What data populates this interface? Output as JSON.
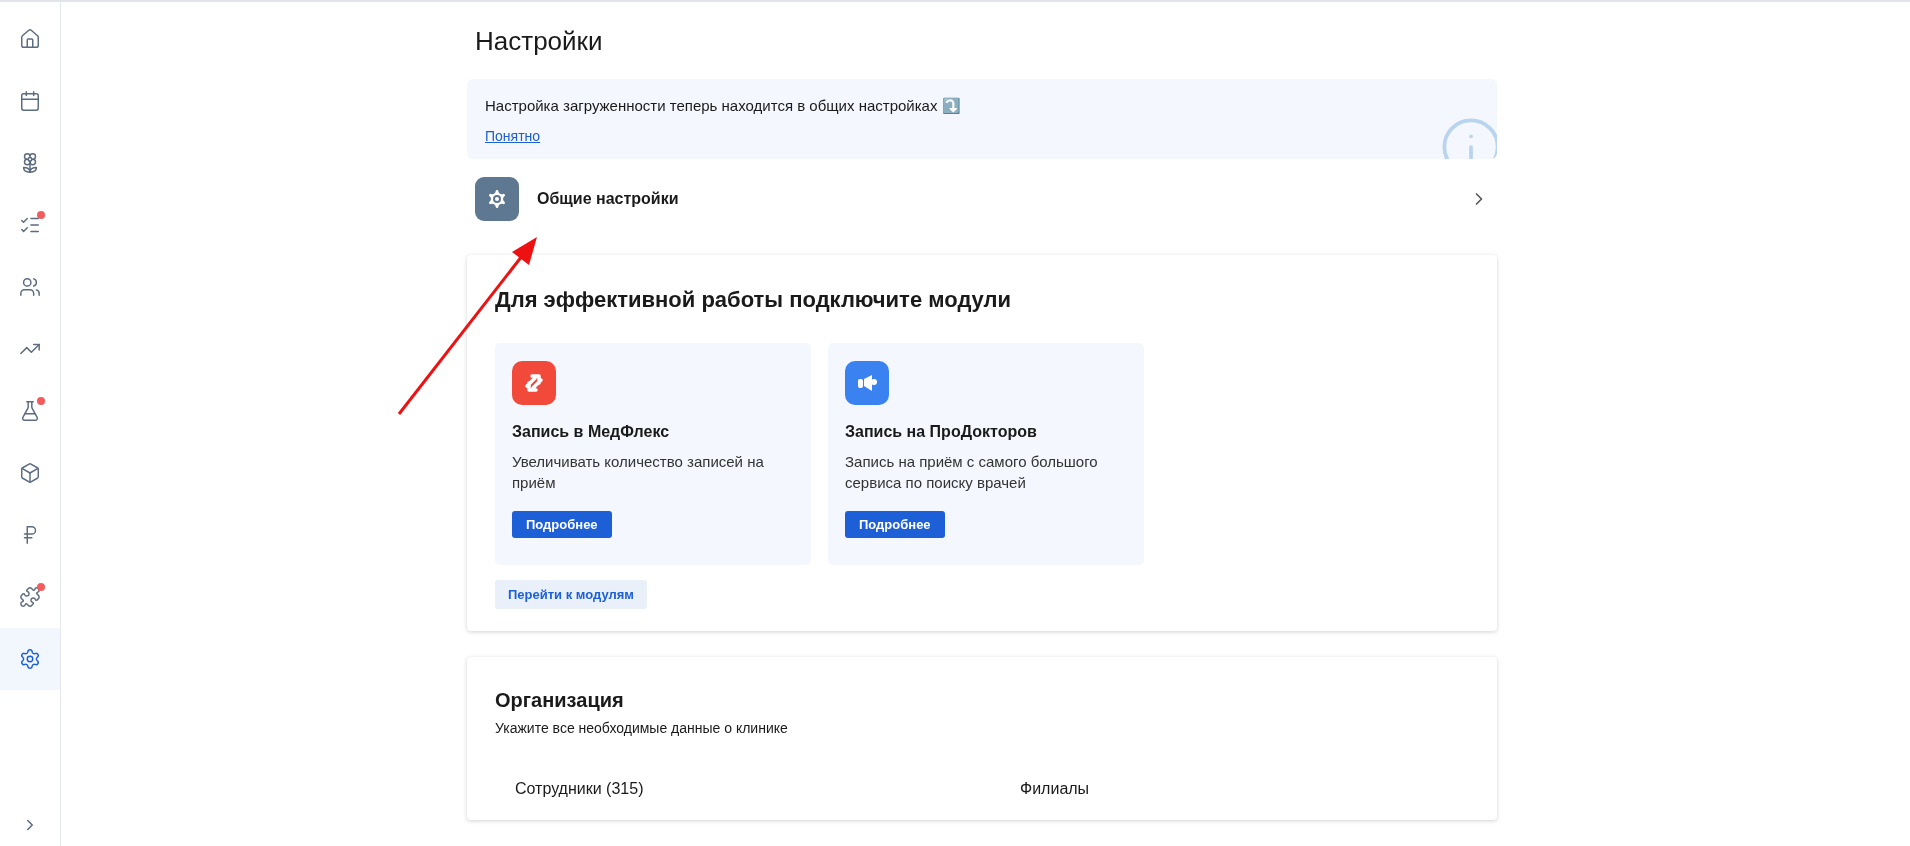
{
  "sidebar": {
    "items": [
      {
        "badge": false,
        "selected": false
      },
      {
        "badge": false,
        "selected": false
      },
      {
        "badge": false,
        "selected": false
      },
      {
        "badge": true,
        "selected": false
      },
      {
        "badge": false,
        "selected": false
      },
      {
        "badge": false,
        "selected": false
      },
      {
        "badge": true,
        "selected": false
      },
      {
        "badge": false,
        "selected": false
      },
      {
        "badge": false,
        "selected": false
      },
      {
        "badge": true,
        "selected": false
      },
      {
        "badge": false,
        "selected": true
      }
    ]
  },
  "title": "Настройки",
  "notice": {
    "text": "Настройка загруженности теперь находится в общих настройках ⤵️",
    "link": "Понятно"
  },
  "general_settings": {
    "label": "Общие настройки"
  },
  "modules": {
    "title": "Для эффективной работы подключите модули",
    "cards": [
      {
        "title": "Запись в МедФлекс",
        "description": "Увеличивать количество записей на приём",
        "button": "Подробнее",
        "color": "#f24a3a"
      },
      {
        "title": "Запись на ПроДокторов",
        "description": "Запись на приём с самого большого сервиса по поиску врачей",
        "button": "Подробнее",
        "color": "#3a82f0"
      }
    ],
    "link": "Перейти к модулям"
  },
  "organization": {
    "title": "Организация",
    "subtitle": "Укажите все необходимые данные о клинике",
    "items": [
      "Сотрудники (315)",
      "Филиалы"
    ]
  }
}
